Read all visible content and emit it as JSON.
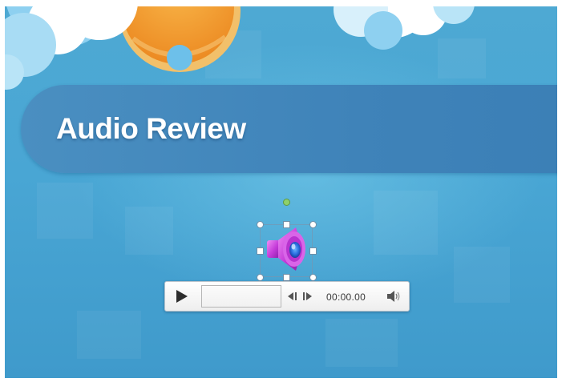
{
  "slide": {
    "title": "Audio Review"
  },
  "media": {
    "icon": "speaker-icon",
    "time": "00:00.00",
    "progress": 0
  },
  "controls": {
    "play_icon": "play-icon",
    "skip_back_icon": "skip-back-icon",
    "skip_forward_icon": "skip-forward-icon",
    "volume_icon": "volume-icon"
  },
  "colors": {
    "background": "#49a6d4",
    "title_bar": "#3f83b9",
    "sun": "#f39a2e",
    "speaker": "#c03fd6",
    "rotation_handle": "#8fd06a"
  }
}
